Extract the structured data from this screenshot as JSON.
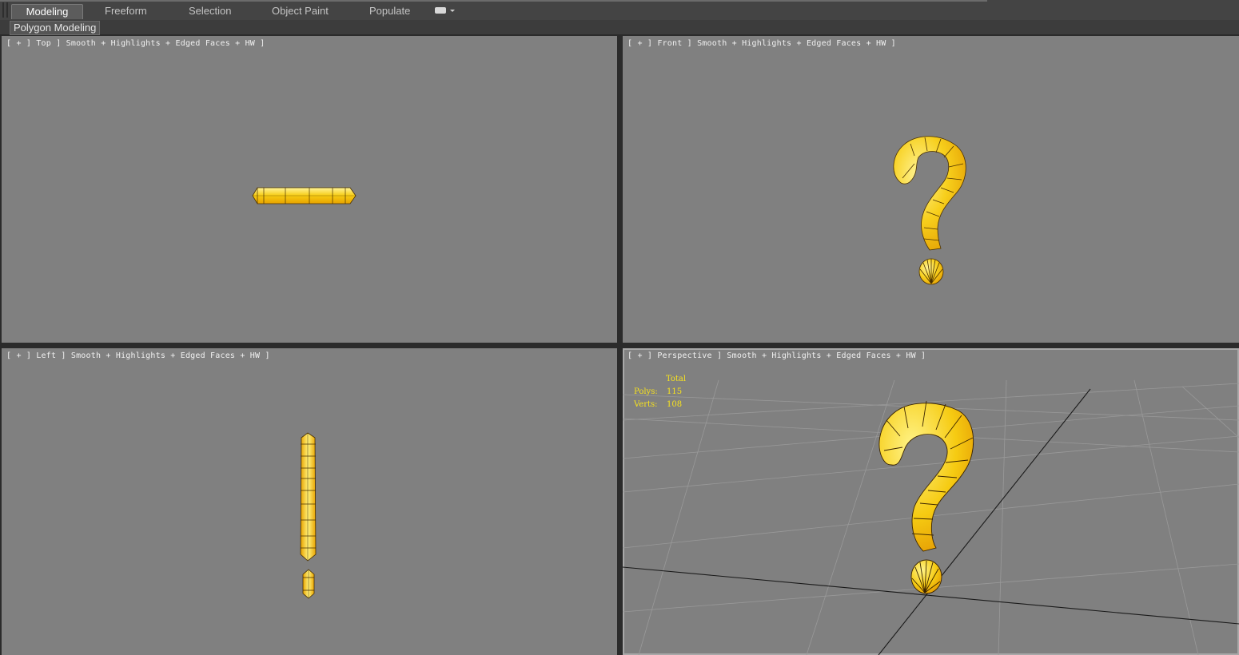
{
  "ribbon": {
    "tabs": [
      {
        "label": "Modeling",
        "active": true
      },
      {
        "label": "Freeform",
        "active": false
      },
      {
        "label": "Selection",
        "active": false
      },
      {
        "label": "Object Paint",
        "active": false
      },
      {
        "label": "Populate",
        "active": false
      }
    ],
    "extra_icon": "toggle-icon"
  },
  "subbar": {
    "label": "Polygon Modeling"
  },
  "viewports": {
    "top": {
      "label": "[ + ] Top ] Smooth + Highlights + Edged Faces + HW ]"
    },
    "front": {
      "label": "[ + ] Front ] Smooth + Highlights + Edged Faces + HW ]"
    },
    "left": {
      "label": "[ + ] Left ] Smooth + Highlights + Edged Faces + HW ]"
    },
    "perspective": {
      "label": "[ + ] Perspective ] Smooth + Highlights + Edged Faces + HW ]"
    }
  },
  "stats": {
    "header": "Total",
    "polys_label": "Polys:",
    "polys_value": "115",
    "verts_label": "Verts:",
    "verts_value": "108"
  },
  "colors": {
    "viewport_bg": "#808080",
    "model_fill": "#f5c518",
    "model_highlight": "#fff27a",
    "model_edge": "#4a3000",
    "stats_text": "#f7e21e"
  }
}
